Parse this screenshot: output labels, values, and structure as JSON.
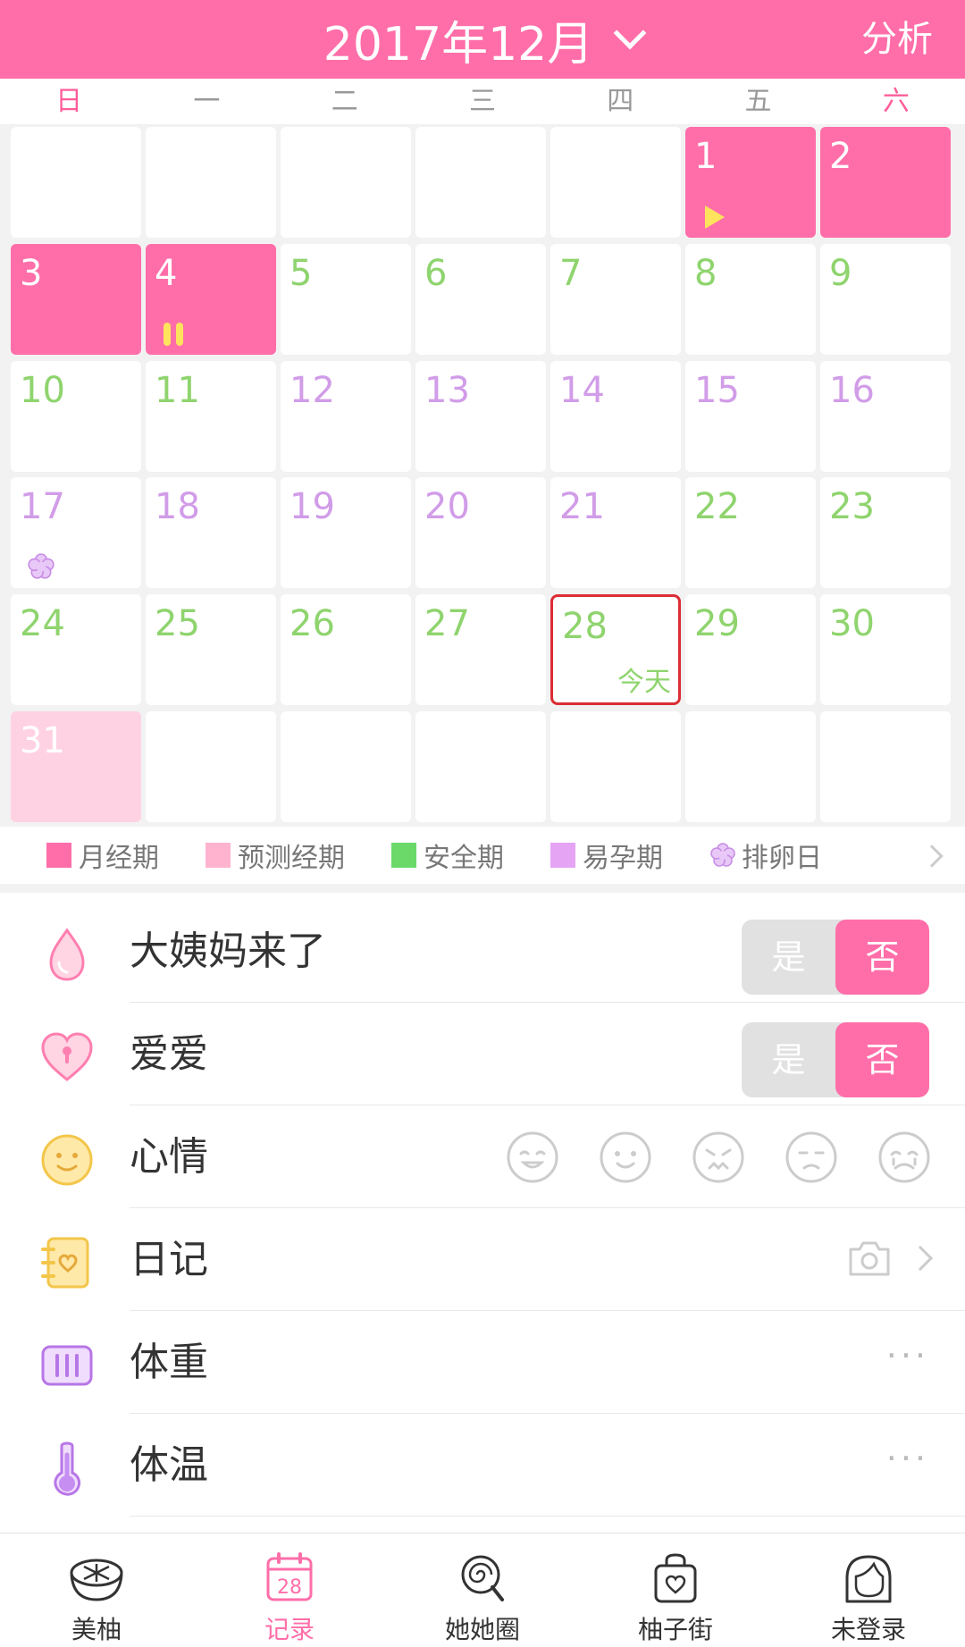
{
  "header": {
    "title": "2017年12月",
    "analysis": "分析"
  },
  "weekdays": [
    "日",
    "一",
    "二",
    "三",
    "四",
    "五",
    "六"
  ],
  "calendar": {
    "today_label": "今天",
    "cells": [
      {
        "row": 0,
        "col": 5,
        "day": "1",
        "type": "period",
        "icon": "play-icon"
      },
      {
        "row": 0,
        "col": 6,
        "day": "2",
        "type": "period"
      },
      {
        "row": 1,
        "col": 0,
        "day": "3",
        "type": "period"
      },
      {
        "row": 1,
        "col": 1,
        "day": "4",
        "type": "period",
        "icon": "pause-icon"
      },
      {
        "row": 1,
        "col": 2,
        "day": "5",
        "type": "safe"
      },
      {
        "row": 1,
        "col": 3,
        "day": "6",
        "type": "safe"
      },
      {
        "row": 1,
        "col": 4,
        "day": "7",
        "type": "safe"
      },
      {
        "row": 1,
        "col": 5,
        "day": "8",
        "type": "safe"
      },
      {
        "row": 1,
        "col": 6,
        "day": "9",
        "type": "safe"
      },
      {
        "row": 2,
        "col": 0,
        "day": "10",
        "type": "safe"
      },
      {
        "row": 2,
        "col": 1,
        "day": "11",
        "type": "safe"
      },
      {
        "row": 2,
        "col": 2,
        "day": "12",
        "type": "fertile"
      },
      {
        "row": 2,
        "col": 3,
        "day": "13",
        "type": "fertile"
      },
      {
        "row": 2,
        "col": 4,
        "day": "14",
        "type": "fertile"
      },
      {
        "row": 2,
        "col": 5,
        "day": "15",
        "type": "fertile"
      },
      {
        "row": 2,
        "col": 6,
        "day": "16",
        "type": "fertile"
      },
      {
        "row": 3,
        "col": 0,
        "day": "17",
        "type": "fertile",
        "icon": "flower-icon"
      },
      {
        "row": 3,
        "col": 1,
        "day": "18",
        "type": "fertile"
      },
      {
        "row": 3,
        "col": 2,
        "day": "19",
        "type": "fertile"
      },
      {
        "row": 3,
        "col": 3,
        "day": "20",
        "type": "fertile"
      },
      {
        "row": 3,
        "col": 4,
        "day": "21",
        "type": "fertile"
      },
      {
        "row": 3,
        "col": 5,
        "day": "22",
        "type": "safe"
      },
      {
        "row": 3,
        "col": 6,
        "day": "23",
        "type": "safe"
      },
      {
        "row": 4,
        "col": 0,
        "day": "24",
        "type": "safe"
      },
      {
        "row": 4,
        "col": 1,
        "day": "25",
        "type": "safe"
      },
      {
        "row": 4,
        "col": 2,
        "day": "26",
        "type": "safe"
      },
      {
        "row": 4,
        "col": 3,
        "day": "27",
        "type": "safe"
      },
      {
        "row": 4,
        "col": 4,
        "day": "28",
        "type": "safe",
        "today": true
      },
      {
        "row": 4,
        "col": 5,
        "day": "29",
        "type": "safe"
      },
      {
        "row": 4,
        "col": 6,
        "day": "30",
        "type": "safe"
      },
      {
        "row": 5,
        "col": 0,
        "day": "31",
        "type": "predicted"
      }
    ]
  },
  "colors": {
    "accent": "#ff6ea9",
    "period": "#ff6ea9",
    "predicted": "#ffd2e3",
    "safe": "#8fd46e",
    "fertile": "#d19ce8",
    "today_border": "#dc2d35"
  },
  "legend": [
    {
      "label": "月经期",
      "color": "#ff6ea9"
    },
    {
      "label": "预测经期",
      "color": "#ffb3cf"
    },
    {
      "label": "安全期",
      "color": "#6ad96a"
    },
    {
      "label": "易孕期",
      "color": "#e6a4f5"
    },
    {
      "label": "排卵日",
      "icon": "flower-icon"
    }
  ],
  "records": {
    "period": {
      "label": "大姨妈来了",
      "yes": "是",
      "no": "否",
      "icon": "drop-icon"
    },
    "love": {
      "label": "爱爱",
      "yes": "是",
      "no": "否",
      "icon": "heart-lock-icon"
    },
    "mood": {
      "label": "心情",
      "icon": "smiley-icon",
      "faces": [
        "happy-face-icon",
        "smile-face-icon",
        "sad-face-icon",
        "unhappy-face-icon",
        "crying-face-icon"
      ]
    },
    "diary": {
      "label": "日记",
      "icon": "notebook-icon"
    },
    "weight": {
      "label": "体重",
      "icon": "scale-icon",
      "more": "···"
    },
    "temperature": {
      "label": "体温",
      "icon": "thermometer-icon",
      "more": "···"
    }
  },
  "tabs": [
    {
      "label": "美柚",
      "icon": "grapefruit-icon"
    },
    {
      "label": "记录",
      "icon": "calendar-icon",
      "badge": "28",
      "active": true
    },
    {
      "label": "她她圈",
      "icon": "lollipop-icon"
    },
    {
      "label": "柚子街",
      "icon": "bag-icon"
    },
    {
      "label": "未登录",
      "icon": "user-icon"
    }
  ]
}
